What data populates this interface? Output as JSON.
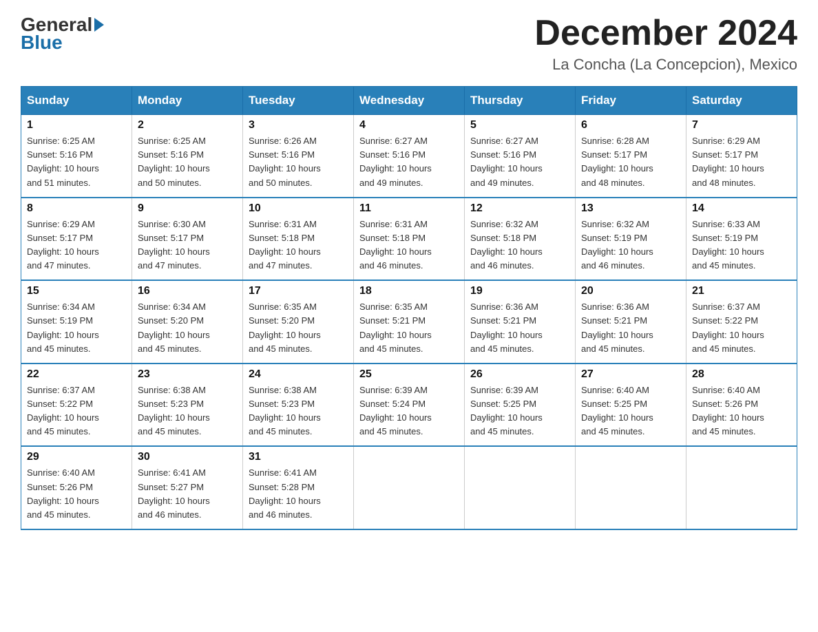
{
  "header": {
    "logo_general": "General",
    "logo_blue": "Blue",
    "month": "December 2024",
    "location": "La Concha (La Concepcion), Mexico"
  },
  "days_of_week": [
    "Sunday",
    "Monday",
    "Tuesday",
    "Wednesday",
    "Thursday",
    "Friday",
    "Saturday"
  ],
  "weeks": [
    [
      {
        "day": "1",
        "sunrise": "6:25 AM",
        "sunset": "5:16 PM",
        "daylight": "10 hours and 51 minutes."
      },
      {
        "day": "2",
        "sunrise": "6:25 AM",
        "sunset": "5:16 PM",
        "daylight": "10 hours and 50 minutes."
      },
      {
        "day": "3",
        "sunrise": "6:26 AM",
        "sunset": "5:16 PM",
        "daylight": "10 hours and 50 minutes."
      },
      {
        "day": "4",
        "sunrise": "6:27 AM",
        "sunset": "5:16 PM",
        "daylight": "10 hours and 49 minutes."
      },
      {
        "day": "5",
        "sunrise": "6:27 AM",
        "sunset": "5:16 PM",
        "daylight": "10 hours and 49 minutes."
      },
      {
        "day": "6",
        "sunrise": "6:28 AM",
        "sunset": "5:17 PM",
        "daylight": "10 hours and 48 minutes."
      },
      {
        "day": "7",
        "sunrise": "6:29 AM",
        "sunset": "5:17 PM",
        "daylight": "10 hours and 48 minutes."
      }
    ],
    [
      {
        "day": "8",
        "sunrise": "6:29 AM",
        "sunset": "5:17 PM",
        "daylight": "10 hours and 47 minutes."
      },
      {
        "day": "9",
        "sunrise": "6:30 AM",
        "sunset": "5:17 PM",
        "daylight": "10 hours and 47 minutes."
      },
      {
        "day": "10",
        "sunrise": "6:31 AM",
        "sunset": "5:18 PM",
        "daylight": "10 hours and 47 minutes."
      },
      {
        "day": "11",
        "sunrise": "6:31 AM",
        "sunset": "5:18 PM",
        "daylight": "10 hours and 46 minutes."
      },
      {
        "day": "12",
        "sunrise": "6:32 AM",
        "sunset": "5:18 PM",
        "daylight": "10 hours and 46 minutes."
      },
      {
        "day": "13",
        "sunrise": "6:32 AM",
        "sunset": "5:19 PM",
        "daylight": "10 hours and 46 minutes."
      },
      {
        "day": "14",
        "sunrise": "6:33 AM",
        "sunset": "5:19 PM",
        "daylight": "10 hours and 45 minutes."
      }
    ],
    [
      {
        "day": "15",
        "sunrise": "6:34 AM",
        "sunset": "5:19 PM",
        "daylight": "10 hours and 45 minutes."
      },
      {
        "day": "16",
        "sunrise": "6:34 AM",
        "sunset": "5:20 PM",
        "daylight": "10 hours and 45 minutes."
      },
      {
        "day": "17",
        "sunrise": "6:35 AM",
        "sunset": "5:20 PM",
        "daylight": "10 hours and 45 minutes."
      },
      {
        "day": "18",
        "sunrise": "6:35 AM",
        "sunset": "5:21 PM",
        "daylight": "10 hours and 45 minutes."
      },
      {
        "day": "19",
        "sunrise": "6:36 AM",
        "sunset": "5:21 PM",
        "daylight": "10 hours and 45 minutes."
      },
      {
        "day": "20",
        "sunrise": "6:36 AM",
        "sunset": "5:21 PM",
        "daylight": "10 hours and 45 minutes."
      },
      {
        "day": "21",
        "sunrise": "6:37 AM",
        "sunset": "5:22 PM",
        "daylight": "10 hours and 45 minutes."
      }
    ],
    [
      {
        "day": "22",
        "sunrise": "6:37 AM",
        "sunset": "5:22 PM",
        "daylight": "10 hours and 45 minutes."
      },
      {
        "day": "23",
        "sunrise": "6:38 AM",
        "sunset": "5:23 PM",
        "daylight": "10 hours and 45 minutes."
      },
      {
        "day": "24",
        "sunrise": "6:38 AM",
        "sunset": "5:23 PM",
        "daylight": "10 hours and 45 minutes."
      },
      {
        "day": "25",
        "sunrise": "6:39 AM",
        "sunset": "5:24 PM",
        "daylight": "10 hours and 45 minutes."
      },
      {
        "day": "26",
        "sunrise": "6:39 AM",
        "sunset": "5:25 PM",
        "daylight": "10 hours and 45 minutes."
      },
      {
        "day": "27",
        "sunrise": "6:40 AM",
        "sunset": "5:25 PM",
        "daylight": "10 hours and 45 minutes."
      },
      {
        "day": "28",
        "sunrise": "6:40 AM",
        "sunset": "5:26 PM",
        "daylight": "10 hours and 45 minutes."
      }
    ],
    [
      {
        "day": "29",
        "sunrise": "6:40 AM",
        "sunset": "5:26 PM",
        "daylight": "10 hours and 45 minutes."
      },
      {
        "day": "30",
        "sunrise": "6:41 AM",
        "sunset": "5:27 PM",
        "daylight": "10 hours and 46 minutes."
      },
      {
        "day": "31",
        "sunrise": "6:41 AM",
        "sunset": "5:28 PM",
        "daylight": "10 hours and 46 minutes."
      },
      null,
      null,
      null,
      null
    ]
  ],
  "labels": {
    "sunrise": "Sunrise:",
    "sunset": "Sunset:",
    "daylight": "Daylight:"
  }
}
